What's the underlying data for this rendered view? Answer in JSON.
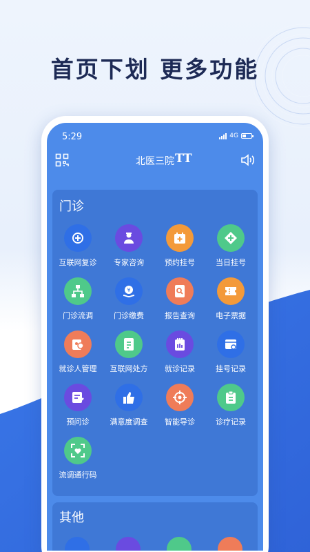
{
  "headline": "首页下划  更多功能",
  "status": {
    "time": "5:29",
    "network": "4G"
  },
  "nav": {
    "title": "北医三院",
    "font_size_label": "TT"
  },
  "sections": {
    "outpatient": {
      "title": "门诊",
      "items": [
        {
          "label": "互联网复诊",
          "icon": "plus-chat-icon",
          "color": "#2f6fe6"
        },
        {
          "label": "专家咨询",
          "icon": "doctor-icon",
          "color": "#6a4be0"
        },
        {
          "label": "预约挂号",
          "icon": "calendar-plus-icon",
          "color": "#f39a3a"
        },
        {
          "label": "当日挂号",
          "icon": "diamond-plus-icon",
          "color": "#4fc98a"
        },
        {
          "label": "门诊流调",
          "icon": "flowchart-icon",
          "color": "#4fc98a"
        },
        {
          "label": "门诊缴费",
          "icon": "yuan-hand-icon",
          "color": "#2f6fe6"
        },
        {
          "label": "报告查询",
          "icon": "report-icon",
          "color": "#ef7c59"
        },
        {
          "label": "电子票据",
          "icon": "ticket-icon",
          "color": "#f39a3a"
        },
        {
          "label": "就诊人管理",
          "icon": "patient-card-icon",
          "color": "#ef7c59"
        },
        {
          "label": "互联网处方",
          "icon": "prescription-icon",
          "color": "#4fc98a"
        },
        {
          "label": "就诊记录",
          "icon": "record-icon",
          "color": "#6a4be0"
        },
        {
          "label": "挂号记录",
          "icon": "calendar-search-icon",
          "color": "#2f6fe6"
        },
        {
          "label": "预问诊",
          "icon": "edit-note-icon",
          "color": "#6a4be0"
        },
        {
          "label": "满意度调查",
          "icon": "thumbs-up-icon",
          "color": "#2f6fe6"
        },
        {
          "label": "智能导诊",
          "icon": "target-icon",
          "color": "#ef7c59"
        },
        {
          "label": "诊疗记录",
          "icon": "clipboard-icon",
          "color": "#4fc98a"
        },
        {
          "label": "流调通行码",
          "icon": "scan-heart-icon",
          "color": "#4fc98a"
        }
      ]
    },
    "other": {
      "title": "其他"
    }
  }
}
